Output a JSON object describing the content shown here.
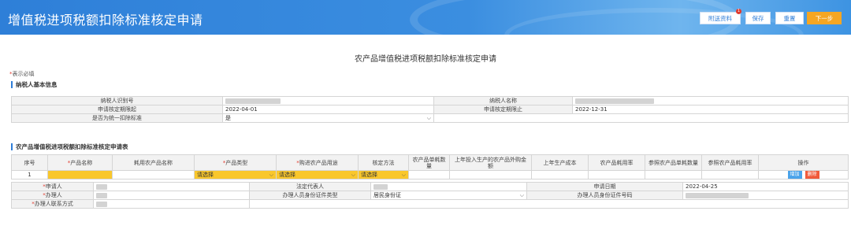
{
  "header": {
    "title": "增值税进项税额扣除标准核定申请",
    "buttons": {
      "attach": "附送资料",
      "attach_badge": "1",
      "save": "保存",
      "reset": "重置",
      "next": "下一步"
    }
  },
  "form_title": "农产品增值税进项税额扣除标准核定申请",
  "required_note": {
    "star": "*",
    "text": "表示必填"
  },
  "basic_section": {
    "title": "纳税人基本信息",
    "taxpayer_id_label": "纳税人识别号",
    "taxpayer_name_label": "纳税人名称",
    "period_start_label": "申请核定期限起",
    "period_start_value": "2022-04-01",
    "period_end_label": "申请核定期限止",
    "period_end_value": "2022-12-31",
    "unified_label": "是否为统一扣除标准",
    "unified_value": "是"
  },
  "apply_section": {
    "title": "农产品增值税进项税额扣除标准核定申请表",
    "columns": [
      "序号",
      "产品名称",
      "耗用农产品名称",
      "产品类型",
      "购进农产品用途",
      "核定方法",
      "农产品单耗数量",
      "上年投入生产的农产品外购金额",
      "上年生产成本",
      "农产品耗用率",
      "参照农产品单耗数量",
      "参照农产品耗用率",
      "操作"
    ],
    "required_mark": "*",
    "row": {
      "index": "1",
      "select_placeholder": "请选择",
      "add": "增加",
      "delete": "删除"
    },
    "applicant_label": "申请人",
    "legal_rep_label": "法定代表人",
    "apply_date_label": "申请日期",
    "apply_date_value": "2022-04-25",
    "handler_label": "办理人",
    "id_type_label": "办理人员身份证件类型",
    "id_type_value": "居民身份证",
    "id_number_label": "办理人员身份证件号码",
    "contact_label": "办理人联系方式"
  },
  "colors": {
    "header_blue": "#2e7fd8",
    "next_orange": "#f5a623",
    "required_yellow": "#f9c72c",
    "add_blue": "#4aa3ea",
    "delete_red": "#f05a3a"
  }
}
